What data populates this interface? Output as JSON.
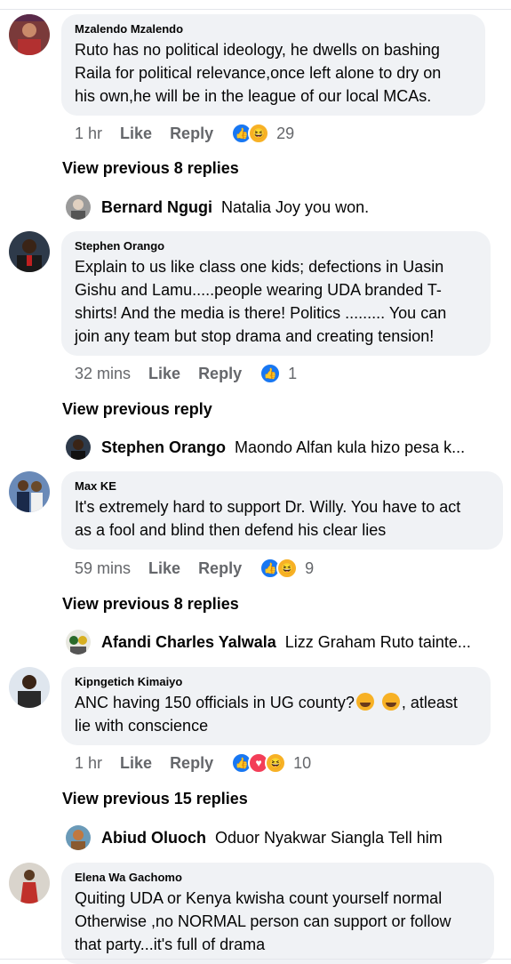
{
  "actions": {
    "like": "Like",
    "reply": "Reply"
  },
  "comments": [
    {
      "author": "Mzalendo Mzalendo",
      "lines": [
        "Ruto has no political ideology, he dwells on bashing",
        "Raila for political relevance,once left alone to dry on",
        "his own,he will be in the league of our local MCAs."
      ],
      "time": "1 hr",
      "reactions": [
        "like",
        "haha"
      ],
      "count": "29",
      "view_previous": "View previous 8 replies",
      "reply": {
        "author": "Bernard Ngugi",
        "text": "Natalia Joy you won."
      }
    },
    {
      "author": "Stephen Orango",
      "lines": [
        "Explain to us like class one kids; defections in Uasin",
        "Gishu and Lamu.....people wearing UDA branded T-",
        "shirts! And the media is there!  Politics ......... You can",
        "join any team but stop drama and creating tension!"
      ],
      "time": "32 mins",
      "reactions": [
        "like"
      ],
      "count": "1",
      "view_previous": "View previous reply",
      "reply": {
        "author": "Stephen Orango",
        "text": "Maondo Alfan kula hizo pesa k..."
      }
    },
    {
      "author": "Max KE",
      "lines": [
        "It's extremely hard to support Dr. Willy. You have to act",
        "as a fool and blind then defend his clear lies"
      ],
      "time": "59 mins",
      "reactions": [
        "like",
        "haha"
      ],
      "count": "9",
      "view_previous": "View previous 8 replies",
      "reply": {
        "author": "Afandi Charles Yalwala",
        "text": "Lizz Graham Ruto tainte..."
      }
    },
    {
      "author": "Kipngetich Kimaiyo",
      "lines": [
        "ANC having 150 officials in UG county?",
        "lie with conscience"
      ],
      "line1_suffix": ", atleast",
      "time": "1 hr",
      "reactions": [
        "like",
        "love",
        "haha"
      ],
      "count": "10",
      "view_previous": "View previous 15 replies",
      "reply": {
        "author": "Abiud Oluoch",
        "text": "Oduor Nyakwar Siangla Tell him"
      }
    },
    {
      "author": "Elena Wa Gachomo",
      "lines": [
        "Quiting UDA or Kenya kwisha count yourself normal",
        "Otherwise ,no NORMAL person can support or  follow",
        "that party...it's full of drama"
      ]
    }
  ]
}
